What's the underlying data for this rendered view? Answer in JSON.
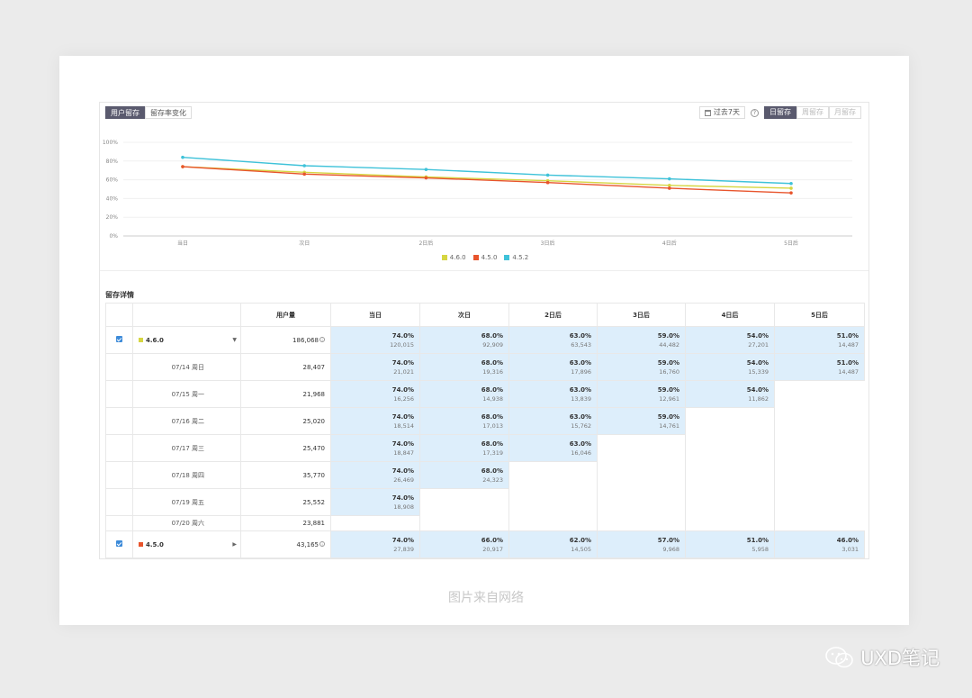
{
  "tabs": [
    {
      "label": "用户留存",
      "active": true
    },
    {
      "label": "留存率变化",
      "active": false
    }
  ],
  "toolbar": {
    "date_range": "过去7天",
    "help": "?",
    "period_buttons": [
      {
        "label": "日留存",
        "active": true
      },
      {
        "label": "周留存",
        "active": false
      },
      {
        "label": "月留存",
        "active": false
      }
    ]
  },
  "chart_data": {
    "type": "line",
    "categories": [
      "当日",
      "次日",
      "2日后",
      "3日后",
      "4日后",
      "5日后"
    ],
    "yticks": [
      "0%",
      "20%",
      "40%",
      "60%",
      "80%",
      "100%"
    ],
    "ylim": [
      0,
      100
    ],
    "series": [
      {
        "name": "4.6.0",
        "color": "#d6d642",
        "values": [
          74,
          68,
          63,
          59,
          54,
          51
        ]
      },
      {
        "name": "4.5.0",
        "color": "#e8542c",
        "values": [
          74,
          66,
          62,
          57,
          51,
          46
        ]
      },
      {
        "name": "4.5.2",
        "color": "#3fc2d9",
        "values": [
          84,
          75,
          71,
          65,
          61,
          56
        ]
      }
    ],
    "legend_position": "bottom"
  },
  "section_title": "留存详情",
  "table": {
    "headers": [
      "",
      "",
      "用户量",
      "当日",
      "次日",
      "2日后",
      "3日后",
      "4日后",
      "5日后"
    ],
    "groups": [
      {
        "version": "4.6.0",
        "color": "#d6d642",
        "caret": "▼",
        "users": "186,068",
        "info": "i",
        "cells": [
          {
            "pct": "74.0%",
            "count": "120,015"
          },
          {
            "pct": "68.0%",
            "count": "92,909"
          },
          {
            "pct": "63.0%",
            "count": "63,543"
          },
          {
            "pct": "59.0%",
            "count": "44,482"
          },
          {
            "pct": "54.0%",
            "count": "27,201"
          },
          {
            "pct": "51.0%",
            "count": "14,487"
          }
        ],
        "rows": [
          {
            "date": "07/14 周日",
            "users": "28,407",
            "cells": [
              {
                "pct": "74.0%",
                "count": "21,021"
              },
              {
                "pct": "68.0%",
                "count": "19,316"
              },
              {
                "pct": "63.0%",
                "count": "17,896"
              },
              {
                "pct": "59.0%",
                "count": "16,760"
              },
              {
                "pct": "54.0%",
                "count": "15,339"
              },
              {
                "pct": "51.0%",
                "count": "14,487"
              }
            ]
          },
          {
            "date": "07/15 周一",
            "users": "21,968",
            "cells": [
              {
                "pct": "74.0%",
                "count": "16,256"
              },
              {
                "pct": "68.0%",
                "count": "14,938"
              },
              {
                "pct": "63.0%",
                "count": "13,839"
              },
              {
                "pct": "59.0%",
                "count": "12,961"
              },
              {
                "pct": "54.0%",
                "count": "11,862"
              }
            ]
          },
          {
            "date": "07/16 周二",
            "users": "25,020",
            "cells": [
              {
                "pct": "74.0%",
                "count": "18,514"
              },
              {
                "pct": "68.0%",
                "count": "17,013"
              },
              {
                "pct": "63.0%",
                "count": "15,762"
              },
              {
                "pct": "59.0%",
                "count": "14,761"
              }
            ]
          },
          {
            "date": "07/17 周三",
            "users": "25,470",
            "cells": [
              {
                "pct": "74.0%",
                "count": "18,847"
              },
              {
                "pct": "68.0%",
                "count": "17,319"
              },
              {
                "pct": "63.0%",
                "count": "16,046"
              }
            ]
          },
          {
            "date": "07/18 周四",
            "users": "35,770",
            "cells": [
              {
                "pct": "74.0%",
                "count": "26,469"
              },
              {
                "pct": "68.0%",
                "count": "24,323"
              }
            ]
          },
          {
            "date": "07/19 周五",
            "users": "25,552",
            "cells": [
              {
                "pct": "74.0%",
                "count": "18,908"
              }
            ]
          },
          {
            "date": "07/20 周六",
            "users": "23,881",
            "cells": []
          }
        ]
      },
      {
        "version": "4.5.0",
        "color": "#e8542c",
        "caret": "▶",
        "users": "43,165",
        "info": "i",
        "cells": [
          {
            "pct": "74.0%",
            "count": "27,839"
          },
          {
            "pct": "66.0%",
            "count": "20,917"
          },
          {
            "pct": "62.0%",
            "count": "14,505"
          },
          {
            "pct": "57.0%",
            "count": "9,968"
          },
          {
            "pct": "51.0%",
            "count": "5,958"
          },
          {
            "pct": "46.0%",
            "count": "3,031"
          }
        ],
        "rows": []
      }
    ]
  },
  "caption": "图片来自网络",
  "watermark": "UXD笔记"
}
